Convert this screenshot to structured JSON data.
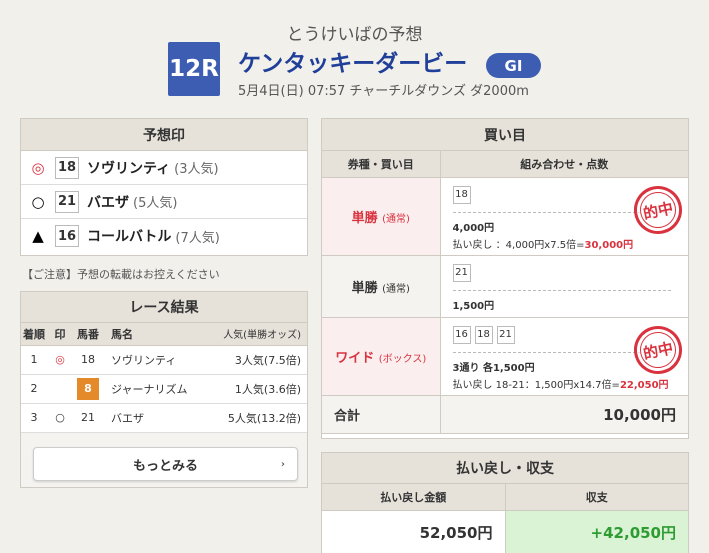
{
  "header": {
    "subtitle": "とうけいばの予想",
    "race_number": "12R",
    "race_name": "ケンタッキーダービー",
    "grade": "GI",
    "race_info": "5月4日(日) 07:57 チャーチルダウンズ ダ2000m"
  },
  "prediction": {
    "title": "予想印",
    "rows": [
      {
        "mark": "◎",
        "number": "18",
        "horse": "ソヴリンティ",
        "popularity": "(3人気)"
      },
      {
        "mark": "○",
        "number": "21",
        "horse": "バエザ",
        "popularity": "(5人気)"
      },
      {
        "mark": "▲",
        "number": "16",
        "horse": "コールバトル",
        "popularity": "(7人気)"
      }
    ],
    "notice": "【ご注意】予想の転載はお控えください"
  },
  "results": {
    "title": "レース結果",
    "headers": [
      "着順",
      "印",
      "馬番",
      "馬名",
      "人気(単勝オッズ)"
    ],
    "rows": [
      {
        "rank": "1",
        "mark": "◎",
        "number": "18",
        "horse": "ソヴリンティ",
        "popularity": "3人気(7.5倍)"
      },
      {
        "rank": "2",
        "mark": "",
        "number": "8",
        "horse": "ジャーナリズム",
        "popularity": "1人気(3.6倍)"
      },
      {
        "rank": "3",
        "mark": "○",
        "number": "21",
        "horse": "バエザ",
        "popularity": "5人気(13.2倍)"
      }
    ],
    "more_label": "もっとみる",
    "more_arrow": "›"
  },
  "bets": {
    "title": "買い目",
    "col_type": "券種・買い目",
    "col_combo": "組み合わせ・点数",
    "rows": [
      {
        "type": "単勝",
        "kind": "(通常)",
        "numbers": [
          "18"
        ],
        "amount": "4,000円",
        "payback_label": "払い戻し ：4,000円x7.5倍=",
        "payback_value": "30,000円",
        "hit": "的中"
      },
      {
        "type": "単勝",
        "kind": "(通常)",
        "numbers": [
          "21"
        ],
        "amount": "1,500円"
      },
      {
        "type": "ワイド",
        "kind": "(ボックス)",
        "numbers": [
          "16",
          "18",
          "21"
        ],
        "amount": "3通り 各1,500円",
        "payback_label": "払い戻し 18-21：1,500円x14.7倍=",
        "payback_value": "22,050円",
        "hit": "的中"
      }
    ],
    "total_label": "合計",
    "total_value": "10,000円"
  },
  "summary": {
    "title": "払い戻し・収支",
    "col_payback": "払い戻し金額",
    "col_profit": "収支",
    "payback": "52,050円",
    "profit": "+42,050円"
  },
  "colors": {
    "accent": "#3d5db3",
    "hit": "#d9333f",
    "profit": "#2f9b33"
  }
}
